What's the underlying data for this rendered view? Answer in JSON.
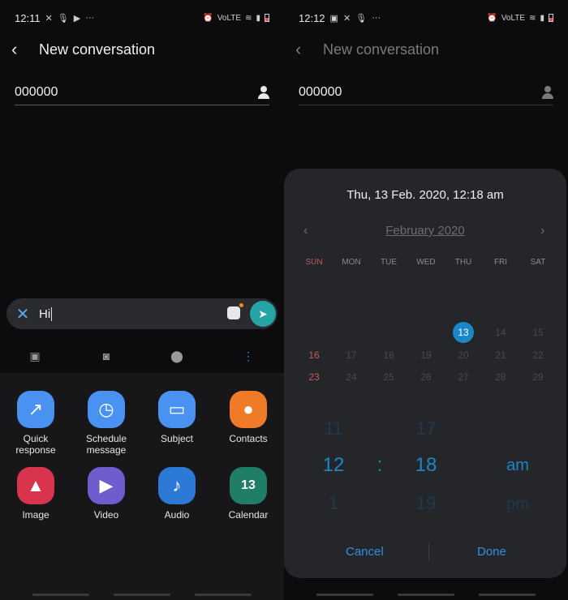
{
  "left": {
    "status": {
      "time": "12:11",
      "icons": [
        "missed-call-icon",
        "mic-icon",
        "youtube-icon",
        "more-icon"
      ],
      "more": "···",
      "right_icons": [
        "alarm-icon",
        "volte-icon",
        "wifi-icon",
        "signal-icon",
        "battery-icon"
      ],
      "volte": "VoLTE"
    },
    "title": "New conversation",
    "recipient": "000000",
    "composer_text": "Hi",
    "tray_apps": [
      {
        "label": "Quick\nresponse",
        "icon": "quick-response-icon",
        "color": "#4a92f2"
      },
      {
        "label": "Schedule\nmessage",
        "icon": "schedule-message-icon",
        "color": "#4a92f2"
      },
      {
        "label": "Subject",
        "icon": "subject-icon",
        "color": "#4a92f2"
      },
      {
        "label": "Contacts",
        "icon": "contacts-icon",
        "color": "#ef7a28"
      },
      {
        "label": "Image",
        "icon": "image-icon",
        "color": "#d8344e"
      },
      {
        "label": "Video",
        "icon": "video-icon",
        "color": "#6f5ccd"
      },
      {
        "label": "Audio",
        "icon": "audio-icon",
        "color": "#2d79d6"
      },
      {
        "label": "Calendar",
        "icon": "calendar-icon",
        "color": "#1f7d68"
      }
    ],
    "calendar_icon_text": "13"
  },
  "right": {
    "status": {
      "time": "12:12",
      "volte": "VoLTE"
    },
    "title": "New conversation",
    "recipient": "000000",
    "dialog": {
      "title": "Thu, 13 Feb. 2020, 12:18 am",
      "month": "February 2020",
      "weekdays": [
        "SUN",
        "MON",
        "TUE",
        "WED",
        "THU",
        "FRI",
        "SAT"
      ],
      "row1": [
        "13",
        "14",
        "15"
      ],
      "row2": [
        "16",
        "17",
        "18",
        "19",
        "20",
        "21",
        "22"
      ],
      "row3": [
        "23",
        "24",
        "25",
        "26",
        "27",
        "28",
        "29"
      ],
      "hour_prev": "11",
      "hour": "12",
      "hour_next": "1",
      "sep": ":",
      "min_prev": "17",
      "min": "18",
      "min_next": "19",
      "ampm": "am",
      "ampm_next": "pm",
      "cancel": "Cancel",
      "done": "Done"
    }
  },
  "colors": {
    "accent": "#1a87c8",
    "send": "#26a3a5",
    "sunday": "#c35a5a"
  }
}
